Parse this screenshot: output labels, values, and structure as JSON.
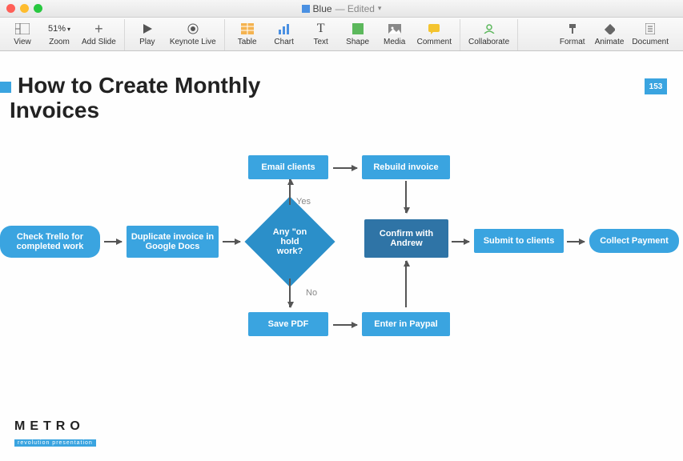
{
  "window": {
    "title": "Blue",
    "status": "— Edited",
    "dropdown": "▾"
  },
  "toolbar": {
    "view": "View",
    "zoom": "Zoom",
    "zoom_value": "51%",
    "add_slide": "Add Slide",
    "play": "Play",
    "keynote_live": "Keynote Live",
    "table": "Table",
    "chart": "Chart",
    "text": "Text",
    "shape": "Shape",
    "media": "Media",
    "comment": "Comment",
    "collaborate": "Collaborate",
    "format": "Format",
    "animate": "Animate",
    "document": "Document"
  },
  "slide": {
    "title_line1": "How to Create Monthly",
    "title_line2": "Invoices",
    "page_number": "153",
    "labels": {
      "yes": "Yes",
      "no": "No"
    },
    "nodes": {
      "check_trello": "Check Trello for completed work",
      "duplicate_invoice": "Duplicate invoice in Google Docs",
      "on_hold": "Any \"on hold work?",
      "email_clients": "Email clients",
      "rebuild_invoice": "Rebuild invoice",
      "confirm_andrew": "Confirm with Andrew",
      "submit_clients": "Submit to clients",
      "collect_payment": "Collect Payment",
      "save_pdf": "Save PDF",
      "enter_paypal": "Enter in Paypal"
    },
    "logo": {
      "brand": "METRO",
      "tagline": "revolution presentation"
    }
  }
}
